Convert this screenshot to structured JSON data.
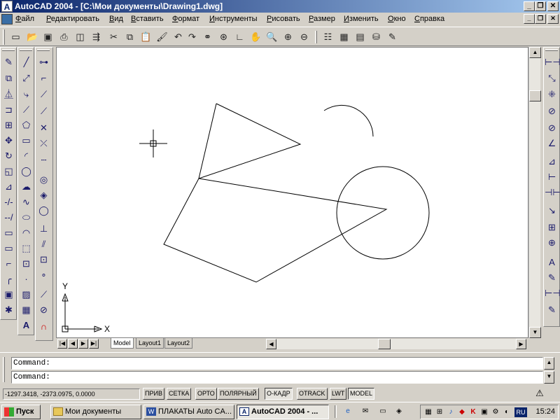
{
  "window": {
    "app_icon": "A",
    "title": "AutoCAD 2004 - [C:\\Мои документы\\Drawing1.dwg]",
    "controls": [
      "_",
      "❐",
      "✕"
    ]
  },
  "menubar": {
    "items": [
      "Файл",
      "Редактировать",
      "Вид",
      "Вставить",
      "Формат",
      "Инструменты",
      "Рисовать",
      "Размер",
      "Изменить",
      "Окно",
      "Справка"
    ],
    "doc_controls": [
      "_",
      "❐",
      "✕"
    ]
  },
  "standard_toolbar": {
    "icons": [
      "new-icon",
      "open-icon",
      "save-icon",
      "plot-icon",
      "preview-icon",
      "publish-icon",
      "cut-icon",
      "copy-icon",
      "paste-icon",
      "matchprop-icon",
      "undo-icon",
      "redo-icon",
      "hyperlink-icon",
      "3dorbit-icon",
      "ucs-icon",
      "realtime-pan-icon",
      "zoom-icon",
      "zoom-window-icon",
      "zoom-previous-icon",
      "properties-icon",
      "designcenter-icon",
      "toolpalette-icon",
      "dbconnect-icon",
      "markup-icon"
    ]
  },
  "draw_toolbar_icons": [
    "line",
    "construction-line",
    "multiline",
    "polyline",
    "polygon",
    "rectangle",
    "arc",
    "circle",
    "revision-cloud",
    "spline",
    "ellipse",
    "ellipse-arc",
    "insert-block",
    "make-block",
    "point",
    "hatch",
    "region",
    "table",
    "multiline-text"
  ],
  "drawing": {
    "ucs_x_label": "X",
    "ucs_y_label": "Y"
  },
  "tabs": {
    "items": [
      "Model",
      "Layout1",
      "Layout2"
    ],
    "active": "Model"
  },
  "command": {
    "lines": [
      "Command:",
      "Command:"
    ]
  },
  "status": {
    "coordinates": "-1297.3418, -2373.0975, 0.0000",
    "toggles": [
      {
        "label": "ПРИВ",
        "on": false
      },
      {
        "label": "СЕТКА",
        "on": false
      },
      {
        "label": "ОРТО",
        "on": false
      },
      {
        "label": "ПОЛЯРНЫЙ",
        "on": false
      },
      {
        "label": "О-КАДР",
        "on": true
      },
      {
        "label": "OTRACK",
        "on": false
      },
      {
        "label": "LWT",
        "on": false
      },
      {
        "label": "MODEL",
        "on": true
      }
    ]
  },
  "taskbar": {
    "start_label": "Пуск",
    "buttons": [
      {
        "label": "Мои документы",
        "icon": "folder-icon",
        "active": false
      },
      {
        "label": "ПЛАКАТЫ Auto CA...",
        "icon": "word-icon",
        "active": false
      },
      {
        "label": "AutoCAD 2004 - ...",
        "icon": "autocad-icon",
        "active": true
      }
    ],
    "language": "RU",
    "clock": "15:24"
  }
}
